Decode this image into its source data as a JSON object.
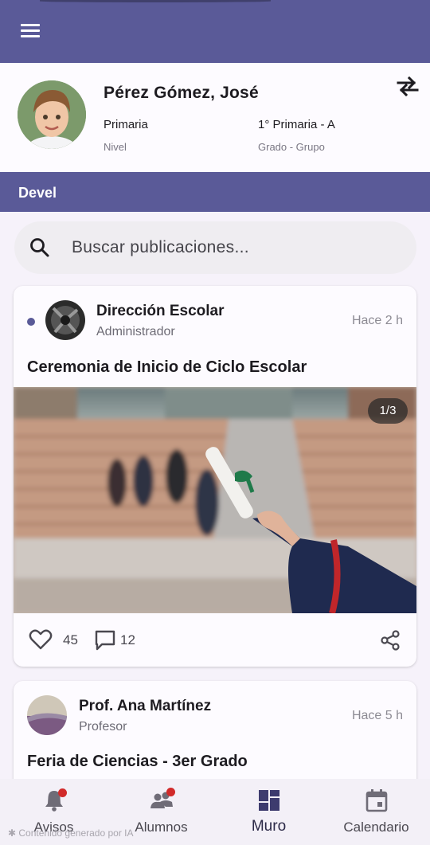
{
  "student": {
    "name": "Pérez Gómez, José",
    "level_value": "Primaria",
    "level_label": "Nivel",
    "group_value": "1° Primaria - A",
    "group_label": "Grado - Grupo"
  },
  "section": {
    "label": "Devel"
  },
  "search": {
    "placeholder": "Buscar publicaciones..."
  },
  "posts": [
    {
      "author": "Dirección Escolar",
      "role": "Administrador",
      "time": "Hace 2 h",
      "title": "Ceremonia de Inicio de Ciclo Escolar",
      "image_counter": "1/3",
      "likes": "45",
      "comments": "12",
      "unread": true
    },
    {
      "author": "Prof. Ana Martínez",
      "role": "Profesor",
      "time": "Hace 5 h",
      "title": "Feria de Ciencias - 3er Grado"
    }
  ],
  "nav": {
    "items": [
      {
        "label": "Avisos",
        "icon": "bell-icon",
        "badge": true
      },
      {
        "label": "Alumnos",
        "icon": "people-icon",
        "badge": true
      },
      {
        "label": "Muro",
        "icon": "dashboard-icon",
        "active": true
      },
      {
        "label": "Calendario",
        "icon": "calendar-icon"
      }
    ]
  },
  "footer_note": "Contenido generado por IA",
  "colors": {
    "primary": "#5a5a98",
    "badge": "#d12a2a",
    "background": "#f6f2fa"
  }
}
